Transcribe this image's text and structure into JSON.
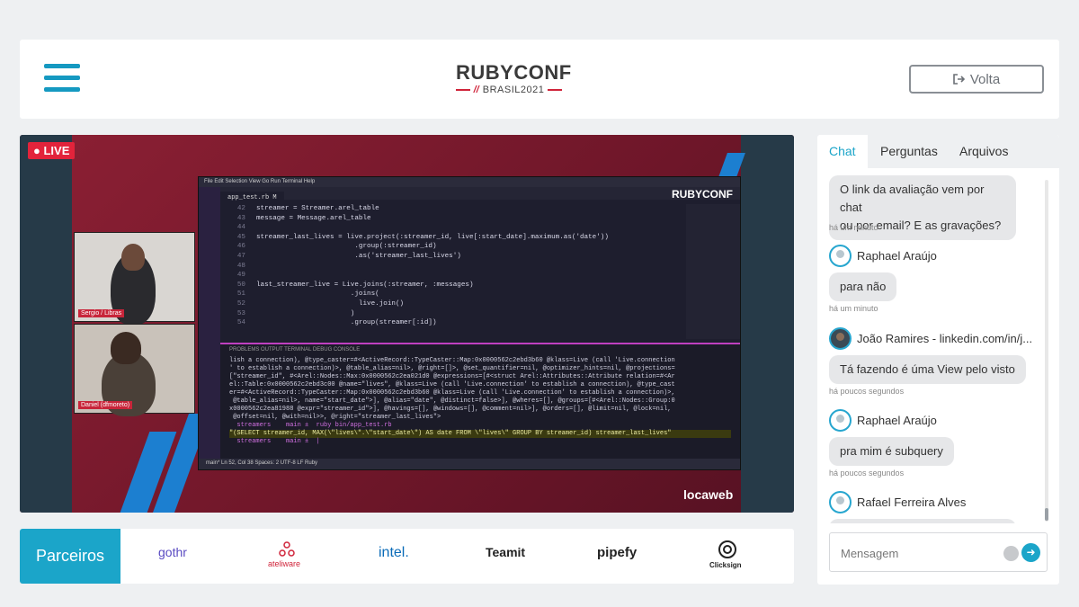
{
  "header": {
    "logo_main": "RUBYCONF",
    "logo_sub": "BRASIL2021",
    "logo_slash": "//",
    "volta_label": "Volta",
    "volta_icon": "sign-out-icon"
  },
  "video": {
    "live_label": "LIVE",
    "cam1_name": "Sergio / Libras",
    "cam2_name": "Daniel (dfmoreto)",
    "locaweb": "locaweb",
    "ide": {
      "menu": "File   Edit   Selection   View   Go   Run   Terminal   Help",
      "tab": "app_test.rb  M",
      "brand": "RUBYCONF",
      "code_lines": [
        {
          "n": "42",
          "t": "streamer = Streamer.arel_table"
        },
        {
          "n": "43",
          "t": "message = Message.arel_table"
        },
        {
          "n": "44",
          "t": ""
        },
        {
          "n": "45",
          "t": "streamer_last_lives = live.project(:streamer_id, live[:start_date].maximum.as('date'))"
        },
        {
          "n": "46",
          "t": "                        .group(:streamer_id)"
        },
        {
          "n": "47",
          "t": "                        .as('streamer_last_lives')"
        },
        {
          "n": "48",
          "t": ""
        },
        {
          "n": "49",
          "t": ""
        },
        {
          "n": "50",
          "t": "last_streamer_live = Live.joins(:streamer, :messages)"
        },
        {
          "n": "51",
          "t": "                       .joins("
        },
        {
          "n": "52",
          "t": "                         live.join()"
        },
        {
          "n": "53",
          "t": "                       )"
        },
        {
          "n": "54",
          "t": "                       .group(streamer[:id])"
        }
      ],
      "terminal_tabs": "PROBLEMS     OUTPUT     TERMINAL     DEBUG CONSOLE",
      "terminal_lines": [
        "lish a connection), @type_caster=#<ActiveRecord::TypeCaster::Map:0x0000562c2ebd3b60 @klass=Live (call 'Live.connection",
        "' to establish a connection)>, @table_alias=nil>, @right=[]>, @set_quantifier=nil, @optimizer_hints=nil, @projections=",
        "[\"streamer_id\", #<Arel::Nodes::Max:0x0000562c2ea021d0 @expressions=[#<struct Arel::Attributes::Attribute relation=#<Ar",
        "el::Table:0x0000562c2ebd3c00 @name=\"lives\", @klass=Live (call 'Live.connection' to establish a connection), @type_cast",
        "er=#<ActiveRecord::TypeCaster::Map:0x0000562c2ebd3b60 @klass=Live (call 'Live.connection' to establish a connection)>,",
        " @table_alias=nil>, name=\"start_date\">], @alias=\"date\", @distinct=false>], @wheres=[], @groups=[#<Arel::Nodes::Group:0",
        "x0000562c2ea81988 @expr=\"streamer_id\">], @havings=[], @windows=[], @comment=nil>], @orders=[], @limit=nil, @lock=nil,",
        " @offset=nil, @with=nil>>, @right=\"streamer_last_lives\">",
        "  streamers    main ±  ruby bin/app_test.rb",
        "\"(SELECT streamer_id, MAX(\\\"lives\\\".\\\"start_date\\\") AS date FROM \\\"lives\\\" GROUP BY streamer_id) streamer_last_lives\"",
        "  streamers    main ±  |"
      ],
      "status": "main*     Ln 52, Col 38   Spaces: 2   UTF-8   LF   Ruby"
    }
  },
  "partners": {
    "label": "Parceiros",
    "items": [
      "gothr",
      "ateliware",
      "intel.",
      "Teamit",
      "pipefy",
      "Clicksign"
    ]
  },
  "chat": {
    "tabs": [
      "Chat",
      "Perguntas",
      "Arquivos"
    ],
    "messages": [
      {
        "author": "",
        "text_lines": [
          "O link da avaliação vem por chat",
          "ou por email? E as gravações?"
        ],
        "time": "há um minuto"
      },
      {
        "author": "Raphael Araújo",
        "text_lines": [
          "para não"
        ],
        "time": "há um minuto"
      },
      {
        "author": "João Ramires - linkedin.com/in/j...",
        "text_lines": [
          "Tá fazendo é úma View pelo visto"
        ],
        "time": "há poucos segundos"
      },
      {
        "author": "Raphael Araújo",
        "text_lines": [
          "pra mim é subquery"
        ],
        "time": "há poucos segundos"
      },
      {
        "author": "Rafael Ferreira Alves",
        "text_lines": [
          ""
        ],
        "time": ""
      }
    ],
    "input_placeholder": "Mensagem",
    "emoji_icon": "smile-icon",
    "send_icon": "send-arrow-icon",
    "accent": "#1ba5c9"
  }
}
